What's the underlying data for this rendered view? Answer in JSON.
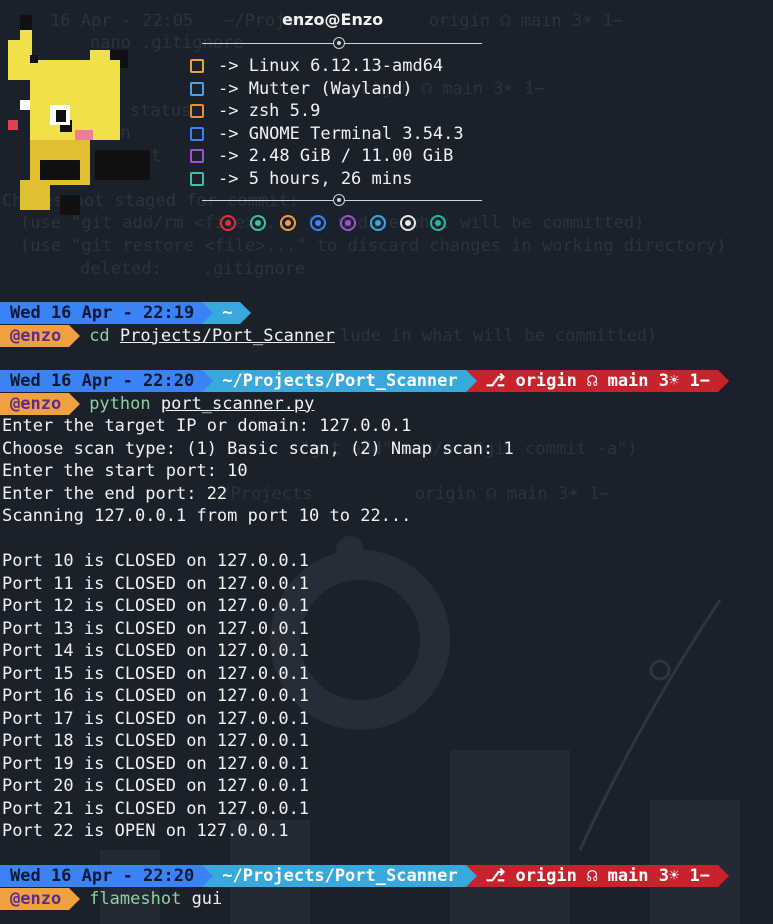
{
  "neofetch": {
    "title": "enzo@Enzo",
    "lines": [
      {
        "icon": "flame-icon",
        "color": "#f0a040",
        "text": "-> Linux 6.12.13-amd64"
      },
      {
        "icon": "window-icon",
        "color": "#4aa3f0",
        "text": "-> Mutter (Wayland)"
      },
      {
        "icon": "shell-icon",
        "color": "#f08a30",
        "text": "-> zsh 5.9"
      },
      {
        "icon": "terminal-icon",
        "color": "#3b82f6",
        "text": "-> GNOME Terminal 3.54.3"
      },
      {
        "icon": "memory-icon",
        "color": "#a050d0",
        "text": "-> 2.48 GiB / 11.00 GiB"
      },
      {
        "icon": "timer-icon",
        "color": "#40c0a0",
        "text": "-> 5 hours, 26 mins"
      }
    ],
    "palette": [
      "#e0313a",
      "#3fc0a0",
      "#f0a040",
      "#3b82f6",
      "#a050d0",
      "#38a9dc",
      "#e8e8e8",
      "#2ab5a0"
    ]
  },
  "prompts": [
    {
      "date": "Wed 16 Apr - 22:19",
      "path": "~",
      "git": "",
      "user": "@enzo",
      "cmd": "cd",
      "arg": "Projects/Port_Scanner"
    },
    {
      "date": "Wed 16 Apr - 22:20",
      "path": "~/Projects/Port_Scanner",
      "git": "⎇ origin ☊ main 3☀ 1−",
      "user": "@enzo",
      "cmd": "python",
      "arg": "port_scanner.py"
    },
    {
      "date": "Wed 16 Apr - 22:20",
      "path": "~/Projects/Port_Scanner",
      "git": "⎇ origin ☊ main 3☀ 1−",
      "user": "@enzo",
      "cmd": "flameshot",
      "arg": "gui"
    }
  ],
  "output": [
    "Enter the target IP or domain: 127.0.0.1",
    "Choose scan type: (1) Basic scan, (2) Nmap scan: 1",
    "Enter the start port: 10",
    "Enter the end port: 22",
    "Scanning 127.0.0.1 from port 10 to 22...",
    "",
    "Port 10 is CLOSED on 127.0.0.1",
    "Port 11 is CLOSED on 127.0.0.1",
    "Port 12 is CLOSED on 127.0.0.1",
    "Port 13 is CLOSED on 127.0.0.1",
    "Port 14 is CLOSED on 127.0.0.1",
    "Port 15 is CLOSED on 127.0.0.1",
    "Port 16 is CLOSED on 127.0.0.1",
    "Port 17 is CLOSED on 127.0.0.1",
    "Port 18 is CLOSED on 127.0.0.1",
    "Port 19 is CLOSED on 127.0.0.1",
    "Port 20 is CLOSED on 127.0.0.1",
    "Port 21 is CLOSED on 127.0.0.1",
    "Port 22 is OPEN on 127.0.0.1"
  ]
}
